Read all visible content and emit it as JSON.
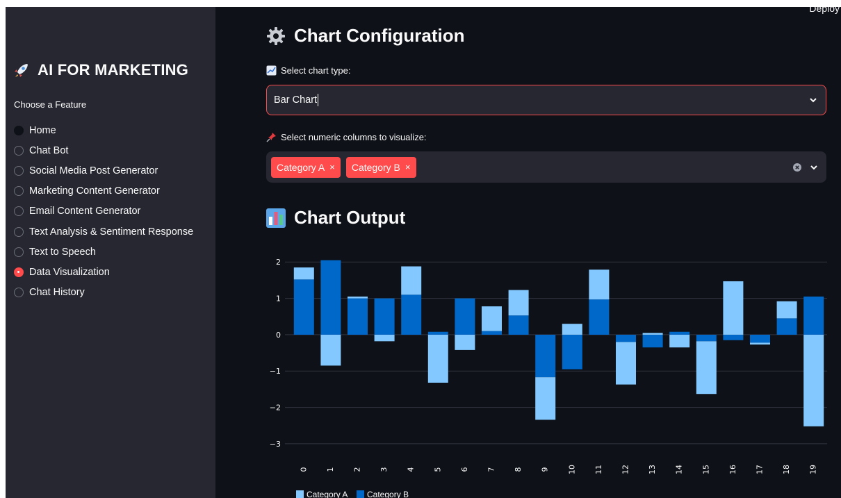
{
  "topbar": {
    "deploy_label": "Deploy"
  },
  "sidebar": {
    "title": "AI FOR MARKETING",
    "feature_label": "Choose a Feature",
    "items": [
      {
        "label": "Home"
      },
      {
        "label": "Chat Bot"
      },
      {
        "label": "Social Media Post Generator"
      },
      {
        "label": "Marketing Content Generator"
      },
      {
        "label": "Email Content Generator"
      },
      {
        "label": "Text Analysis & Sentiment Response"
      },
      {
        "label": "Text to Speech"
      },
      {
        "label": "Data Visualization"
      },
      {
        "label": "Chat History"
      }
    ],
    "selected_index": 7
  },
  "config": {
    "heading": "Chart Configuration",
    "chart_type_label": "Select chart type:",
    "chart_type_value": "Bar Chart",
    "columns_label": "Select numeric columns to visualize:",
    "columns": [
      "Category A",
      "Category B"
    ],
    "remove_symbol": "×"
  },
  "output": {
    "heading": "Chart Output"
  },
  "colors": {
    "accent": "#ff4b4b",
    "series_a": "#83c9ff",
    "series_b": "#0068c9",
    "sidebar_bg": "#262730",
    "main_bg": "#0e1117"
  },
  "chart_data": {
    "type": "bar",
    "stacked": true,
    "categories": [
      "0",
      "1",
      "2",
      "3",
      "4",
      "5",
      "6",
      "7",
      "8",
      "9",
      "10",
      "11",
      "12",
      "13",
      "14",
      "15",
      "16",
      "17",
      "18",
      "19"
    ],
    "series": [
      {
        "name": "Category A",
        "values": [
          0.33,
          -0.85,
          0.05,
          -0.18,
          0.78,
          -1.32,
          -0.42,
          0.68,
          0.7,
          -1.17,
          0.3,
          0.82,
          -1.17,
          0.05,
          -0.35,
          -1.45,
          1.47,
          -0.05,
          0.47,
          -2.52
        ]
      },
      {
        "name": "Category B",
        "values": [
          1.52,
          2.05,
          1.0,
          1.0,
          1.1,
          0.08,
          1.0,
          0.1,
          0.53,
          -1.17,
          -0.95,
          0.97,
          -0.2,
          -0.35,
          0.08,
          -0.18,
          -0.15,
          -0.22,
          0.45,
          1.05
        ]
      }
    ],
    "yticks": [
      2,
      1,
      0,
      -1,
      -2,
      -3
    ],
    "ylim": [
      -3.25,
      2.1
    ],
    "grid": true,
    "legend": "bottom-left"
  }
}
